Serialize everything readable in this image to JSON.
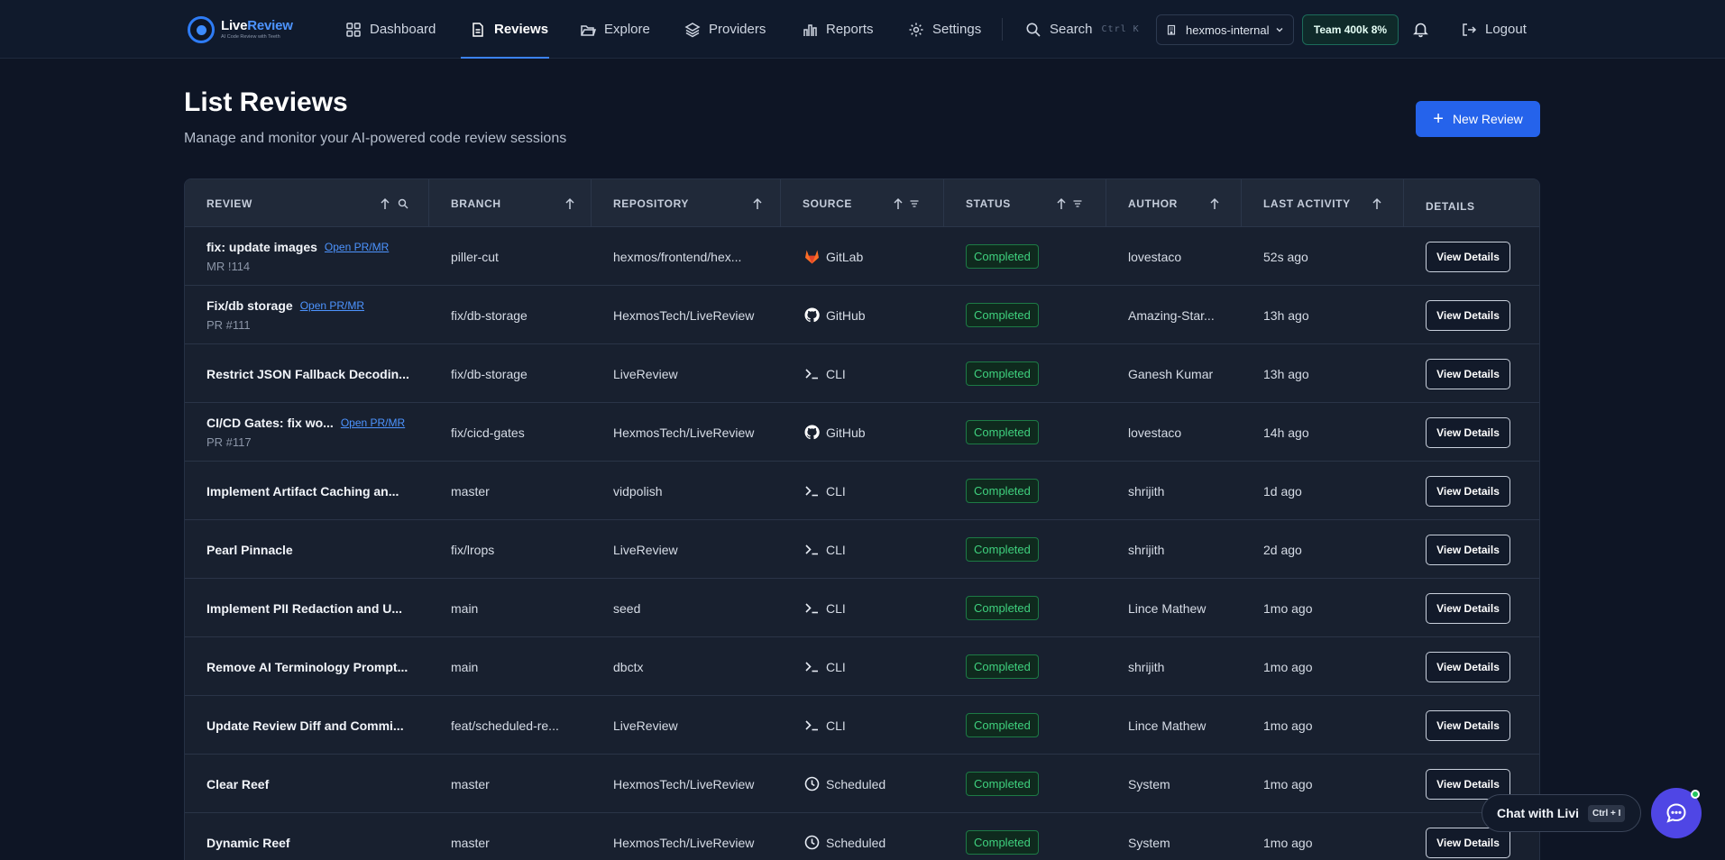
{
  "brand": {
    "name_part1": "Live",
    "name_part2": "Review",
    "tagline": "AI Code Review with Teeth"
  },
  "nav": {
    "items": [
      {
        "label": "Dashboard",
        "icon": "grid-icon"
      },
      {
        "label": "Reviews",
        "icon": "document-icon",
        "active": true
      },
      {
        "label": "Explore",
        "icon": "folder-open-icon"
      },
      {
        "label": "Providers",
        "icon": "layers-icon"
      },
      {
        "label": "Reports",
        "icon": "bar-chart-icon"
      },
      {
        "label": "Settings",
        "icon": "gear-icon"
      }
    ],
    "search_label": "Search",
    "search_shortcut": "Ctrl K",
    "org": "hexmos-internal",
    "team_badge": "Team 400k 8%",
    "logout": "Logout"
  },
  "header": {
    "title": "List Reviews",
    "subtitle": "Manage and monitor your AI-powered code review sessions",
    "new_button": "New Review"
  },
  "table": {
    "columns": [
      "REVIEW",
      "BRANCH",
      "REPOSITORY",
      "SOURCE",
      "STATUS",
      "AUTHOR",
      "LAST ACTIVITY",
      "DETAILS"
    ],
    "open_pr_label": "Open PR/MR",
    "view_label": "View Details",
    "rows": [
      {
        "title": "fix: update images",
        "pr": "MR !114",
        "branch": "piller-cut",
        "repo": "hexmos/frontend/hex...",
        "source": "GitLab",
        "source_icon": "gitlab-icon",
        "status": "Completed",
        "author": "lovestaco",
        "activity": "52s ago"
      },
      {
        "title": "Fix/db storage",
        "pr": "PR #111",
        "branch": "fix/db-storage",
        "repo": "HexmosTech/LiveReview",
        "source": "GitHub",
        "source_icon": "github-icon",
        "status": "Completed",
        "author": "Amazing-Star...",
        "activity": "13h ago"
      },
      {
        "title": "Restrict JSON Fallback Decodin...",
        "pr": "",
        "branch": "fix/db-storage",
        "repo": "LiveReview",
        "source": "CLI",
        "source_icon": "terminal-icon",
        "status": "Completed",
        "author": "Ganesh Kumar",
        "activity": "13h ago"
      },
      {
        "title": "CI/CD Gates: fix wo...",
        "pr": "PR #117",
        "branch": "fix/cicd-gates",
        "repo": "HexmosTech/LiveReview",
        "source": "GitHub",
        "source_icon": "github-icon",
        "status": "Completed",
        "author": "lovestaco",
        "activity": "14h ago"
      },
      {
        "title": "Implement Artifact Caching an...",
        "pr": "",
        "branch": "master",
        "repo": "vidpolish",
        "source": "CLI",
        "source_icon": "terminal-icon",
        "status": "Completed",
        "author": "shrijith",
        "activity": "1d ago"
      },
      {
        "title": "Pearl Pinnacle",
        "pr": "",
        "branch": "fix/lrops",
        "repo": "LiveReview",
        "source": "CLI",
        "source_icon": "terminal-icon",
        "status": "Completed",
        "author": "shrijith",
        "activity": "2d ago"
      },
      {
        "title": "Implement PII Redaction and U...",
        "pr": "",
        "branch": "main",
        "repo": "seed",
        "source": "CLI",
        "source_icon": "terminal-icon",
        "status": "Completed",
        "author": "Lince Mathew",
        "activity": "1mo ago"
      },
      {
        "title": "Remove AI Terminology Prompt...",
        "pr": "",
        "branch": "main",
        "repo": "dbctx",
        "source": "CLI",
        "source_icon": "terminal-icon",
        "status": "Completed",
        "author": "shrijith",
        "activity": "1mo ago"
      },
      {
        "title": "Update Review Diff and Commi...",
        "pr": "",
        "branch": "feat/scheduled-re...",
        "repo": "LiveReview",
        "source": "CLI",
        "source_icon": "terminal-icon",
        "status": "Completed",
        "author": "Lince Mathew",
        "activity": "1mo ago"
      },
      {
        "title": "Clear Reef",
        "pr": "",
        "branch": "master",
        "repo": "HexmosTech/LiveReview",
        "source": "Scheduled",
        "source_icon": "clock-icon",
        "status": "Completed",
        "author": "System",
        "activity": "1mo ago"
      },
      {
        "title": "Dynamic Reef",
        "pr": "",
        "branch": "master",
        "repo": "HexmosTech/LiveReview",
        "source": "Scheduled",
        "source_icon": "clock-icon",
        "status": "Completed",
        "author": "System",
        "activity": "1mo ago"
      }
    ]
  },
  "chat": {
    "label": "Chat with Livi",
    "shortcut": "Ctrl + I"
  },
  "colors": {
    "accent": "#2563eb",
    "status_completed": "#3fd17e",
    "background": "#0e1525",
    "gitlab": "#fc6d26"
  }
}
